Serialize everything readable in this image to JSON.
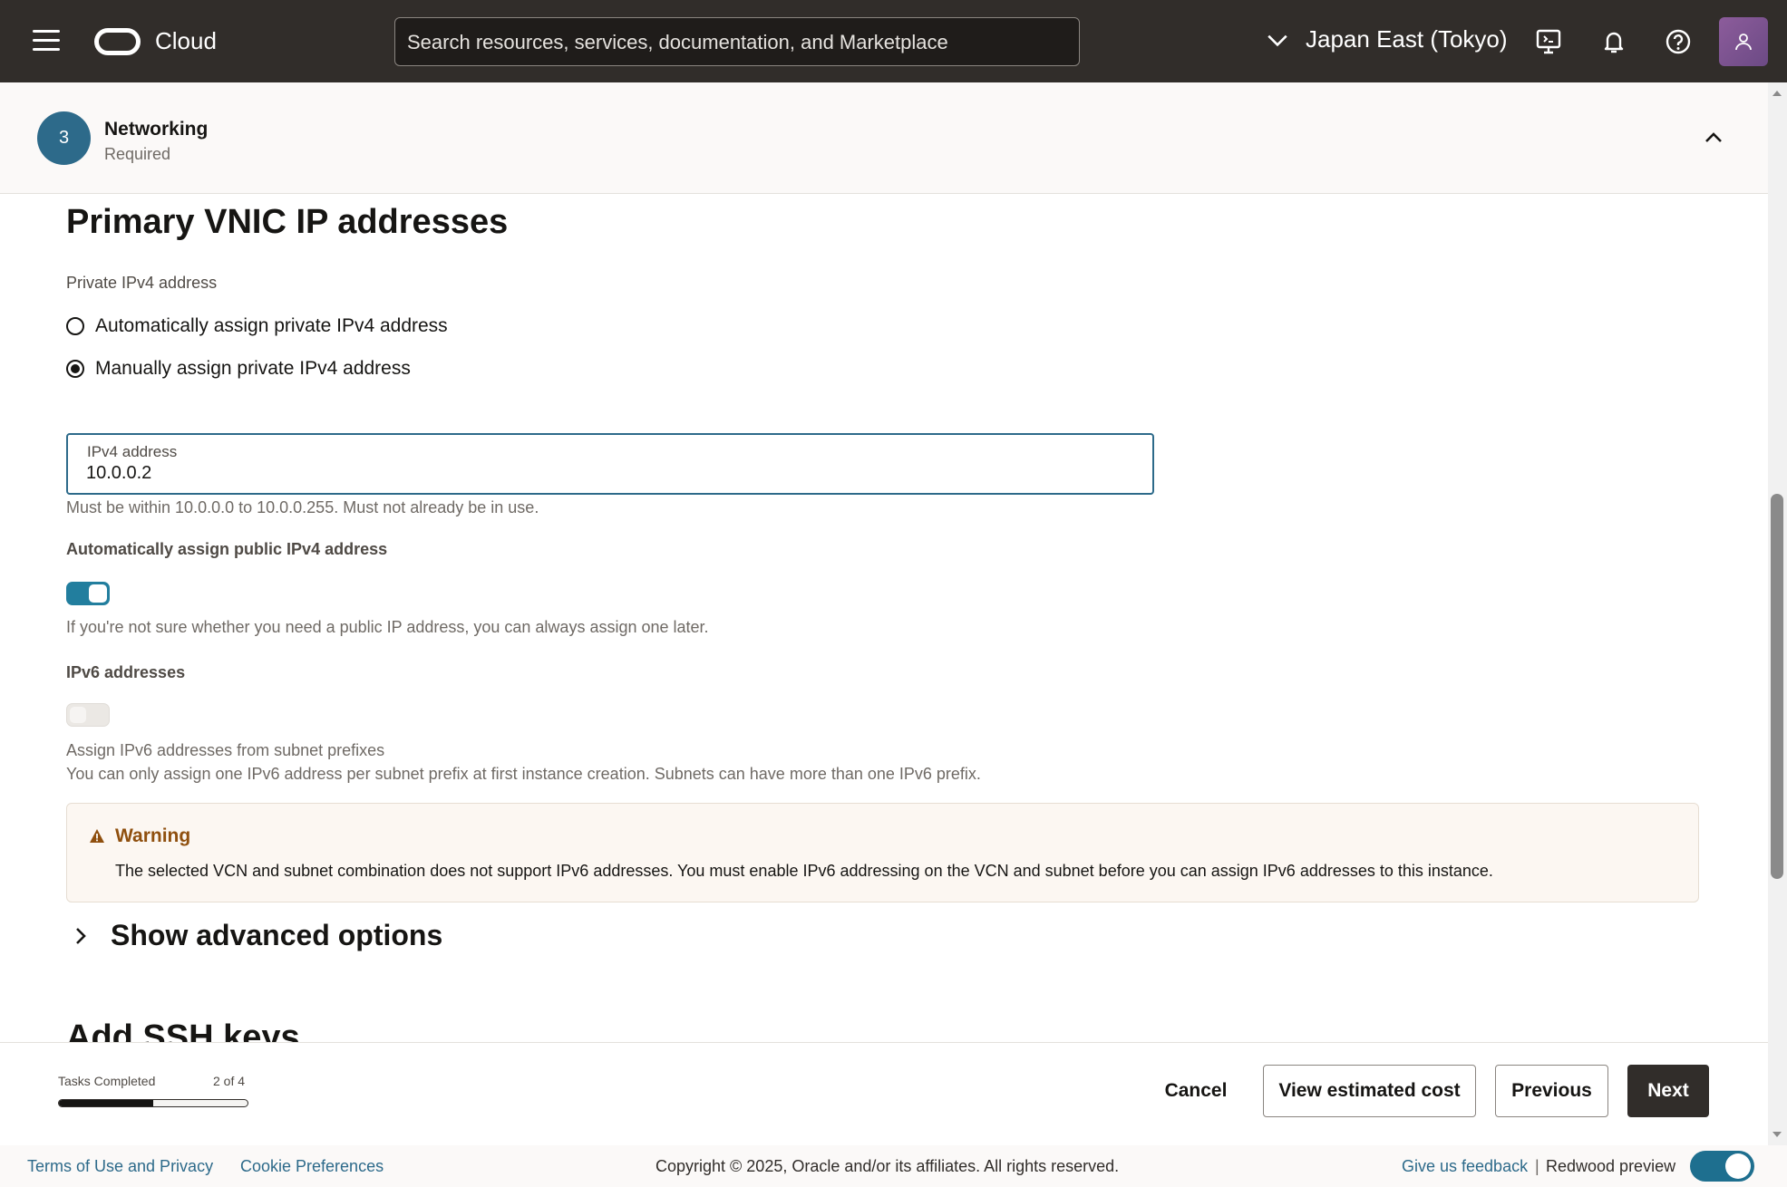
{
  "topbar": {
    "brand": "Cloud",
    "search_placeholder": "Search resources, services, documentation, and Marketplace",
    "region": "Japan East (Tokyo)"
  },
  "step": {
    "number": "3",
    "title": "Networking",
    "subtitle": "Required"
  },
  "section": {
    "title": "Primary VNIC IP addresses",
    "private_label": "Private IPv4 address",
    "radio_auto": "Automatically assign private IPv4 address",
    "radio_manual": "Manually assign private IPv4 address",
    "selected": "manual",
    "ipv4_field_label": "IPv4 address",
    "ipv4_value": "10.0.0.2",
    "ipv4_hint": "Must be within 10.0.0.0 to 10.0.0.255. Must not already be in use.",
    "public_label": "Automatically assign public IPv4 address",
    "public_toggle_on": true,
    "public_hint": "If you're not sure whether you need a public IP address, you can always assign one later.",
    "ipv6_label": "IPv6 addresses",
    "ipv6_toggle_on": false,
    "ipv6_hint_1": "Assign IPv6 addresses from subnet prefixes",
    "ipv6_hint_2": "You can only assign one IPv6 address per subnet prefix at first instance creation. Subnets can have more than one IPv6 prefix.",
    "warning_title": "Warning",
    "warning_text": "The selected VCN and subnet combination does not support IPv6 addresses. You must enable IPv6 addressing on the VCN and subnet before you can assign IPv6 addresses to this instance.",
    "advanced_label": "Show advanced options",
    "next_section_title": "Add SSH keys"
  },
  "actionbar": {
    "tasks_label": "Tasks Completed",
    "tasks_count": "2 of 4",
    "tasks_progress": 0.5,
    "cancel": "Cancel",
    "view_cost": "View estimated cost",
    "previous": "Previous",
    "next": "Next"
  },
  "footer": {
    "terms": "Terms of Use and Privacy",
    "cookies": "Cookie Preferences",
    "copyright": "Copyright © 2025, Oracle and/or its affiliates. All rights reserved.",
    "feedback": "Give us feedback",
    "separator": "|",
    "redwood": "Redwood preview",
    "redwood_on": true
  },
  "colors": {
    "topbar": "#312d2a",
    "accent": "#227e9e",
    "warning": "#8f4f0e"
  }
}
